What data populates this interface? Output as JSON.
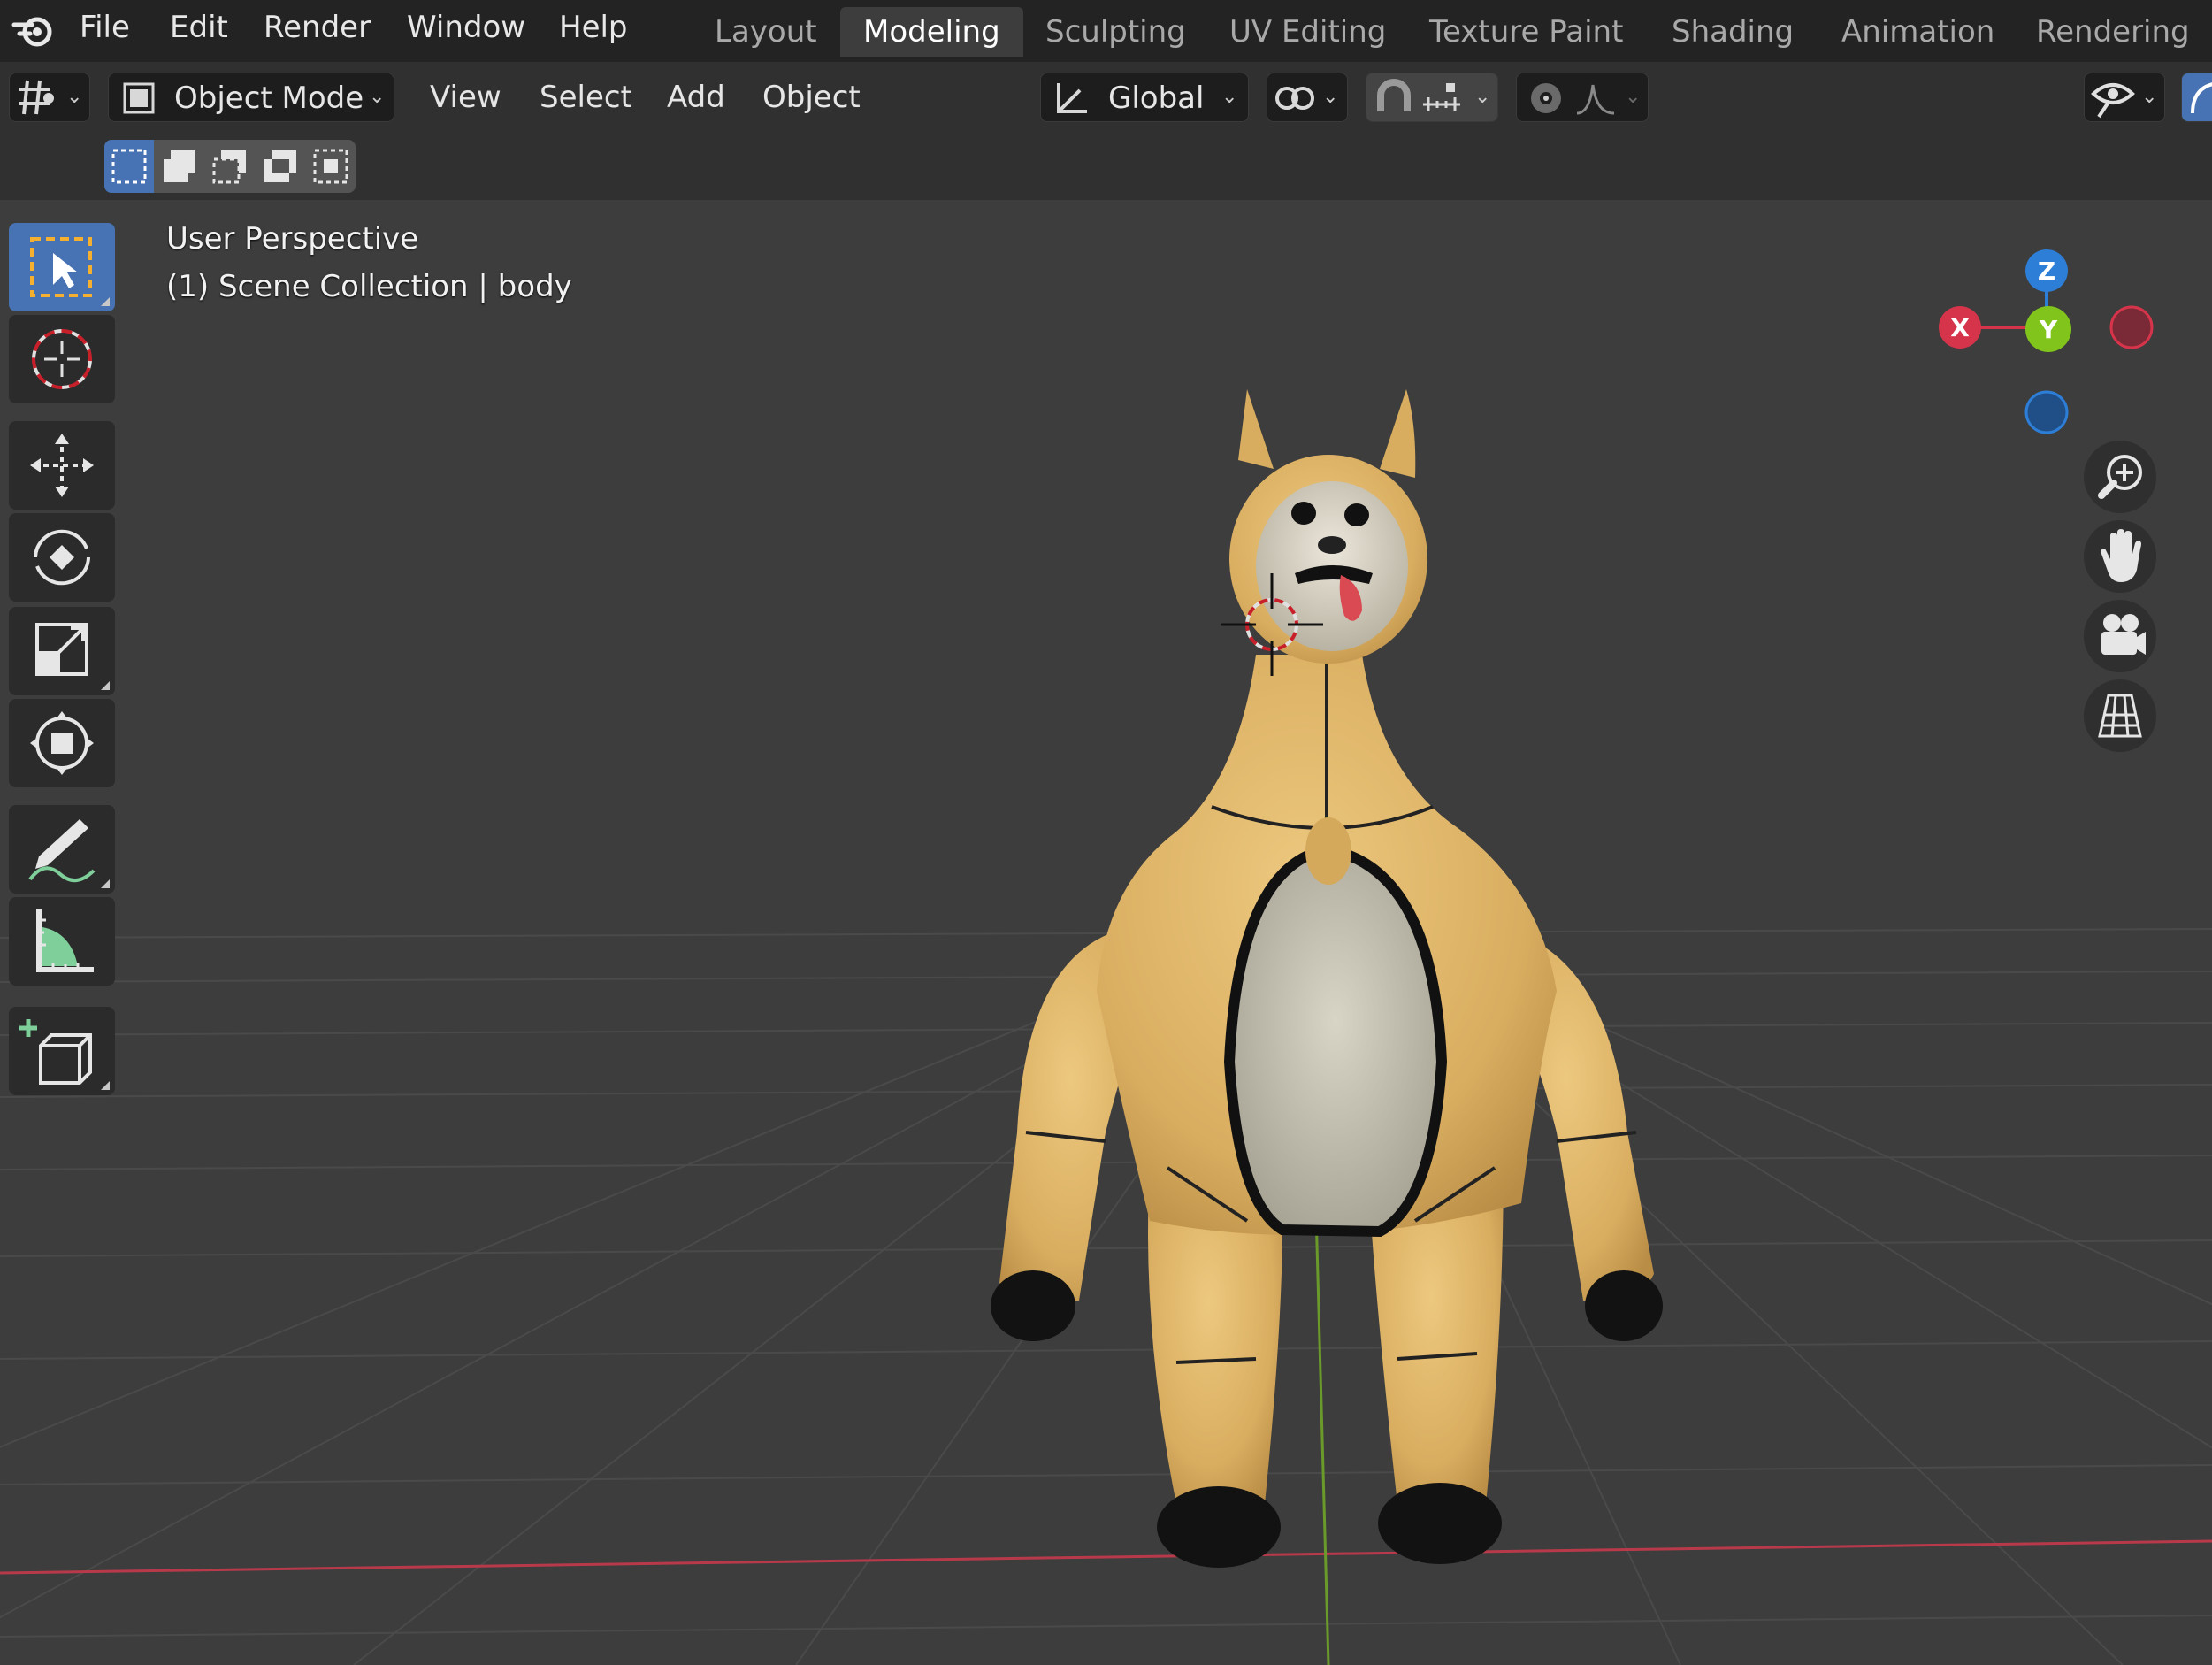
{
  "app_menu": {
    "items": [
      "File",
      "Edit",
      "Render",
      "Window",
      "Help"
    ]
  },
  "workspaces": {
    "tabs": [
      "Layout",
      "Modeling",
      "Sculpting",
      "UV Editing",
      "Texture Paint",
      "Shading",
      "Animation",
      "Rendering"
    ],
    "active": "Modeling"
  },
  "header": {
    "mode_label": "Object Mode",
    "menus": [
      "View",
      "Select",
      "Add",
      "Object"
    ],
    "transform_orientation": "Global"
  },
  "viewport": {
    "view_name": "User Perspective",
    "collection_info": "(1) Scene Collection | body"
  },
  "gizmo": {
    "x_label": "X",
    "y_label": "Y",
    "z_label": "Z",
    "colors": {
      "x": "#d6344a",
      "y": "#80c41c",
      "z": "#2d7ed6"
    }
  },
  "colors": {
    "accent": "#4772b3",
    "background": "#3d3d3d",
    "topbar": "#232323"
  }
}
